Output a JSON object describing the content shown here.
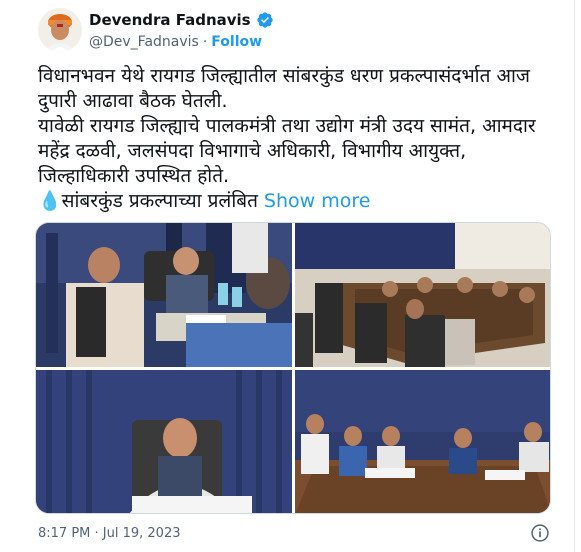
{
  "author": {
    "display_name": "Devendra Fadnavis",
    "handle": "@Dev_Fadnavis",
    "separator": "·",
    "follow_label": "Follow",
    "verified_icon": "verified-badge-icon",
    "avatar_icon": "profile-avatar"
  },
  "tweet": {
    "line1": "विधानभवन येथे रायगड जिल्ह्यातील सांबरकुंड धरण प्रकल्पासंदर्भात आज दुपारी आढावा बैठक घेतली.",
    "line2": "यावेळी रायगड जिल्ह्याचे पालकमंत्री तथा उद्योग मंत्री उदय सामंत, आमदार महेंद्र दळवी, जलसंपदा विभागाचे अधिकारी, विभागीय आयुक्त, जिल्हाधिकारी उपस्थित होते.",
    "drop_emoji": "💧",
    "line3": "सांबरकुंड प्रकल्पाच्या प्रलंबित",
    "show_more": "Show more"
  },
  "media": {
    "photos": [
      "meeting-photo-1",
      "meeting-photo-2",
      "meeting-photo-3",
      "meeting-photo-4"
    ]
  },
  "timestamp": "8:17 PM · Jul 19, 2023",
  "colors": {
    "accent": "#1d9bf0",
    "text": "#0f1419",
    "muted": "#536471"
  }
}
